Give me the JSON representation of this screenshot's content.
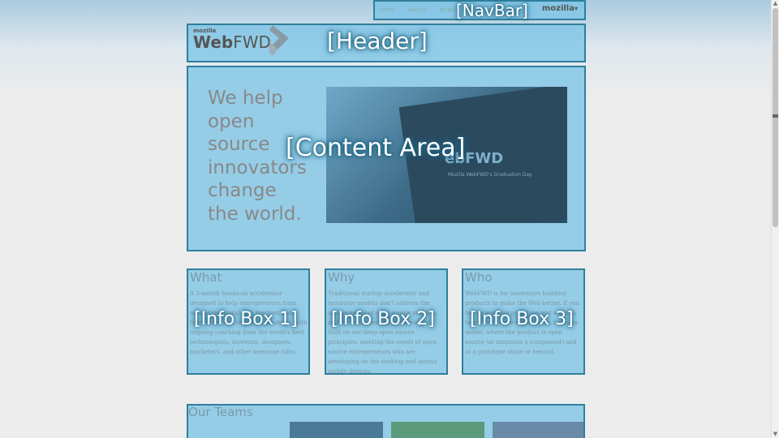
{
  "navbar": {
    "overlay_label": "[NavBar]",
    "links": [
      "HOME",
      "ABOUT",
      "NEWS"
    ],
    "mozilla_label": "mozilla",
    "mozilla_chevron": "▾"
  },
  "header": {
    "overlay_label": "[Header]",
    "logo_small": "mozilla",
    "logo_bold": "Web",
    "logo_light": "FWD"
  },
  "content": {
    "overlay_label": "[Content Area]",
    "tagline": "We help open source innovators change the world.",
    "hero_title": "ebFWD",
    "hero_subtitle": "Mozilla WebFWD's Graduation Day"
  },
  "info_boxes": [
    {
      "overlay_label": "[Info Box 1]",
      "title": "What",
      "body": "A 3-month hands-on accelerator designed to help entrepreneurs from around the world gain traction, build their team, and ship their products, with ongoing coaching from the world's best technologists, investors, designers, marketers, and other awesome folks."
    },
    {
      "overlay_label": "[Info Box 2]",
      "title": "Why",
      "body": "Traditional startup accelerator and incubator models don't address the unique needs of open source projects, so Mozilla is creating an accelerator built on our deep open source principles, meeting the needs of open source entrepreneurs who are developing on the desktop and across mobile devices."
    },
    {
      "overlay_label": "[Info Box 3]",
      "title": "Who",
      "body": "WebFWD is for innovators building products to make the Web better. If you have a working prototype and an early team, and you're exploring its business model, where the product is open source (at minimum a component) and at a prototype stage or beyond."
    }
  ],
  "teams": {
    "title": "Our Teams"
  },
  "colors": {
    "overlay_fill": "#78c3e6",
    "overlay_border": "#2f7f9c",
    "background": "#ececec"
  },
  "icons": {
    "logo_arrow": "chevron-arrow-icon",
    "dropdown": "chevron-down-icon"
  }
}
